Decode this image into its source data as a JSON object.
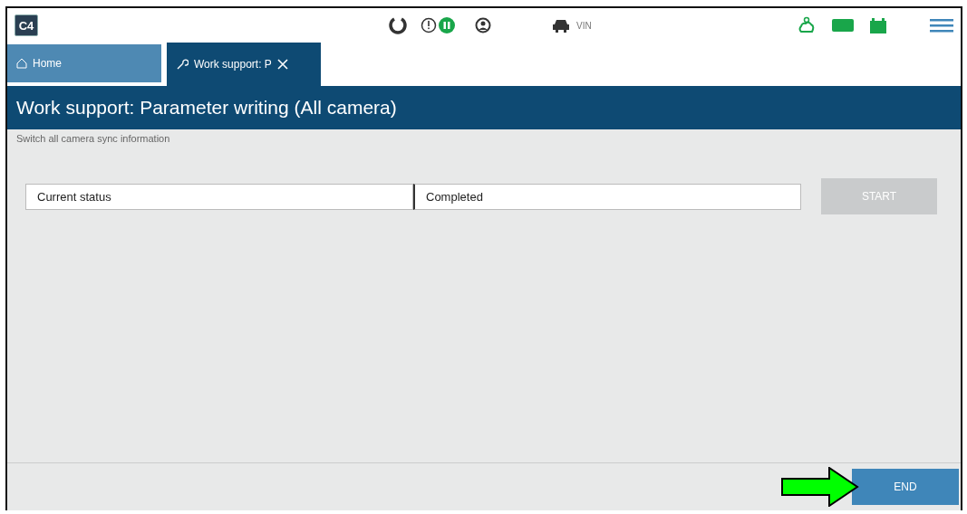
{
  "header": {
    "logo": "C4",
    "vin_label": "VIN"
  },
  "tabs": [
    {
      "label": "Home",
      "kind": "home",
      "selected": false
    },
    {
      "label": "Work support: P",
      "kind": "work",
      "selected": true
    }
  ],
  "title": "Work support: Parameter writing (All camera)",
  "subtitle": "Switch all camera sync information",
  "status_row": {
    "label": "Current status",
    "value": "Completed"
  },
  "start_button": {
    "label": "START",
    "disabled": true
  },
  "end_button": {
    "label": "END",
    "disabled": false
  }
}
